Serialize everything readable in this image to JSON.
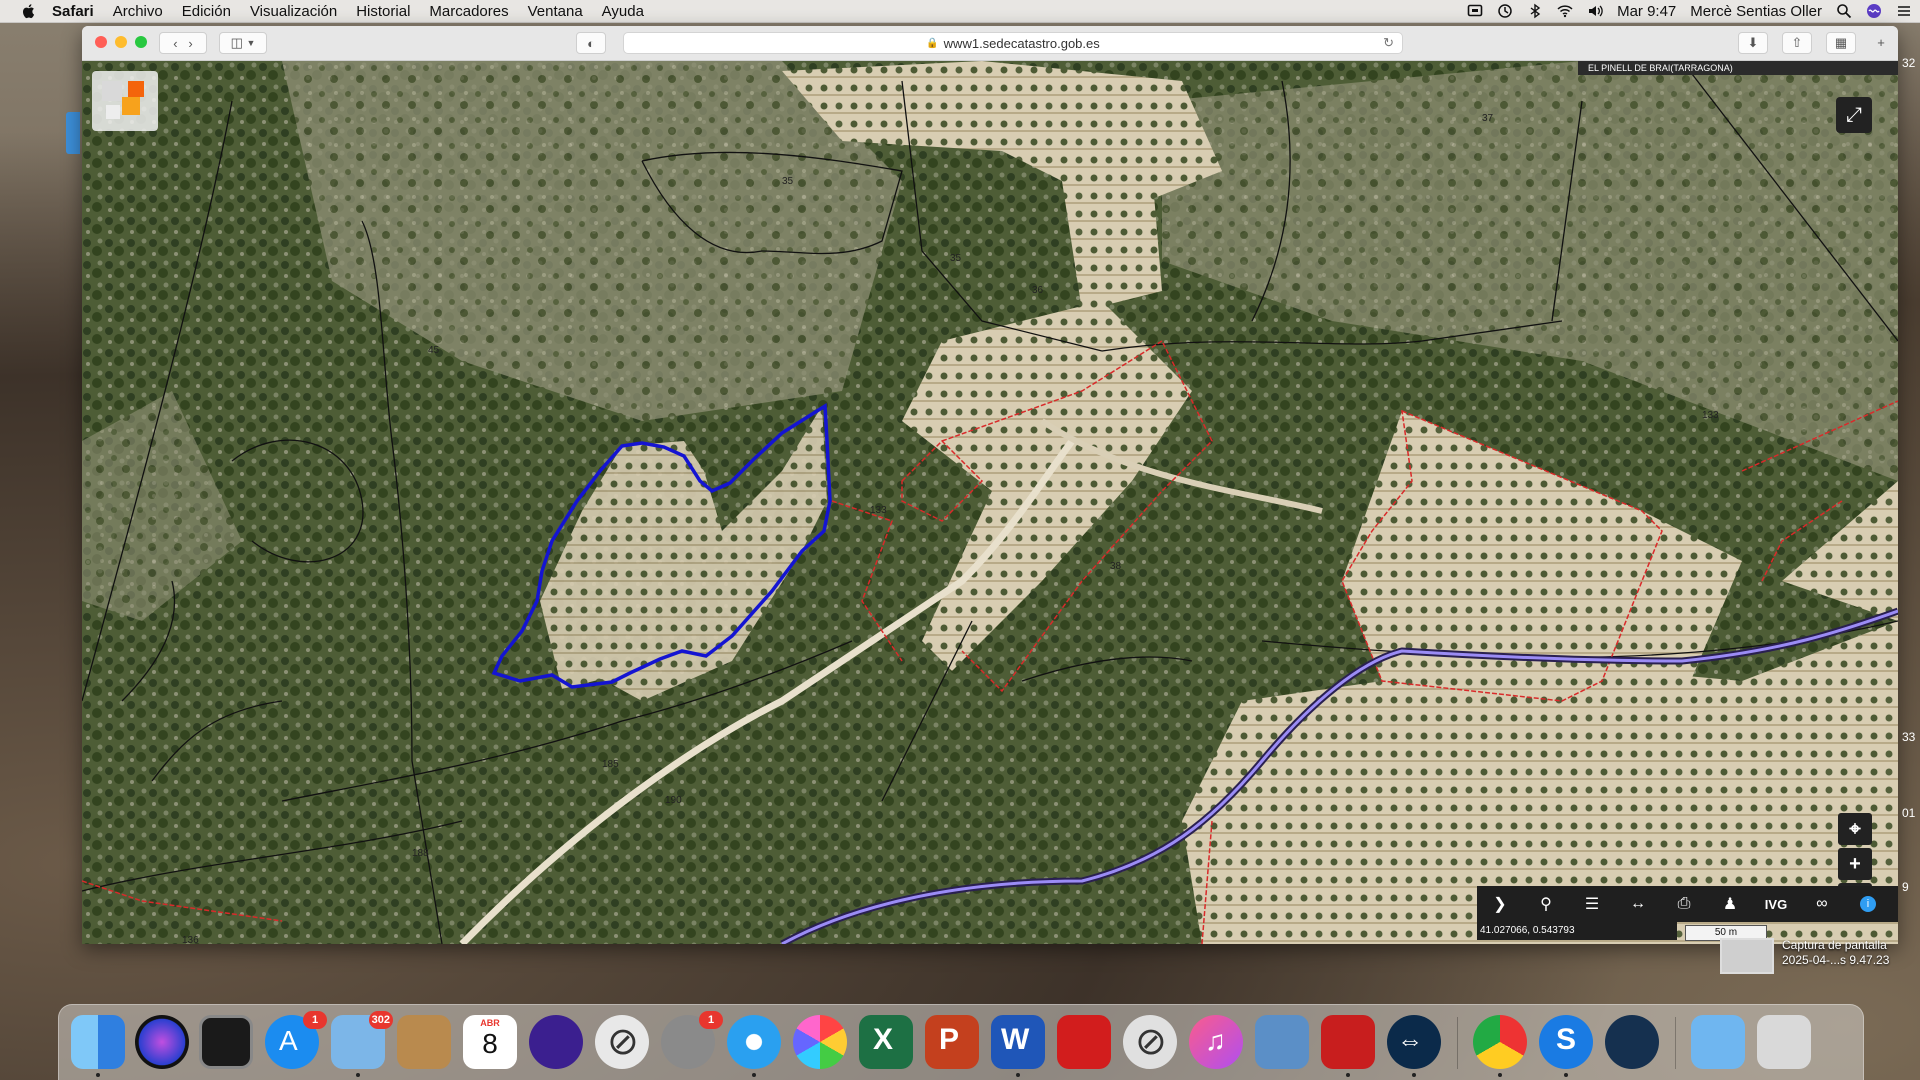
{
  "menubar": {
    "app_name": "Safari",
    "items": [
      "Archivo",
      "Edición",
      "Visualización",
      "Historial",
      "Marcadores",
      "Ventana",
      "Ayuda"
    ],
    "clock": "Mar 9:47",
    "user": "Mercè Sentias Oller",
    "icons": [
      "apple-icon",
      "airplay-icon",
      "time-machine-icon",
      "bluetooth-icon",
      "wifi-icon",
      "volume-icon",
      "search-icon",
      "siri-icon",
      "control-center-icon"
    ]
  },
  "browser": {
    "url": "www1.sedecatastro.gob.es"
  },
  "map": {
    "place_label": "EL PINELL DE BRAI(TARRAGONA)",
    "coordinates": "41.027066, 0.543793",
    "scale_label": "50 m",
    "parcel_labels": [
      "35",
      "38",
      "36",
      "45",
      "43",
      "133",
      "185",
      "190",
      "188",
      "136",
      "37"
    ],
    "tool_ivg_label": "IVG",
    "colors": {
      "selected_parcel": "#1414d2",
      "parcel_border_red": "#d92a2a",
      "road_purple": "#9b8cf5",
      "boundary_black": "#111111"
    }
  },
  "desktop": {
    "edge_labels": [
      "32",
      "33",
      "01",
      "9"
    ],
    "screenshot_label": "Captura de pantalla",
    "screenshot_date": "2025-04-...s 9.47.23"
  },
  "dock": {
    "badges": {
      "app_store": "1",
      "mail": "302",
      "system_prefs": "1"
    },
    "calendar_month": "ABR",
    "calendar_day": "8"
  }
}
